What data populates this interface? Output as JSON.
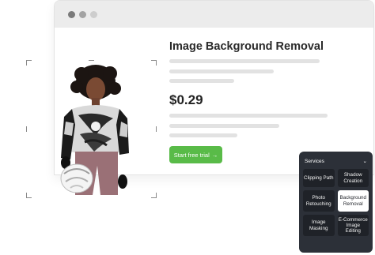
{
  "product": {
    "title": "Image Background Removal",
    "price": "$0.29",
    "cta_label": "Start free trial",
    "cta_arrow": "→"
  },
  "services": {
    "header": "Services",
    "chevron": "⌄",
    "items": [
      {
        "label": "Clipping Path",
        "active": false
      },
      {
        "label": "Shadow Creation",
        "active": false
      },
      {
        "label": "Photo Retouching",
        "active": false
      },
      {
        "label": "Background Removal",
        "active": true
      },
      {
        "label": "Image Masking",
        "active": false
      },
      {
        "label": "E-Commerce Image Editing",
        "active": false
      }
    ]
  },
  "colors": {
    "cta": "#59bb48",
    "panel": "#2c3038",
    "tile": "#1f2228",
    "active_tile": "#ffffff"
  }
}
